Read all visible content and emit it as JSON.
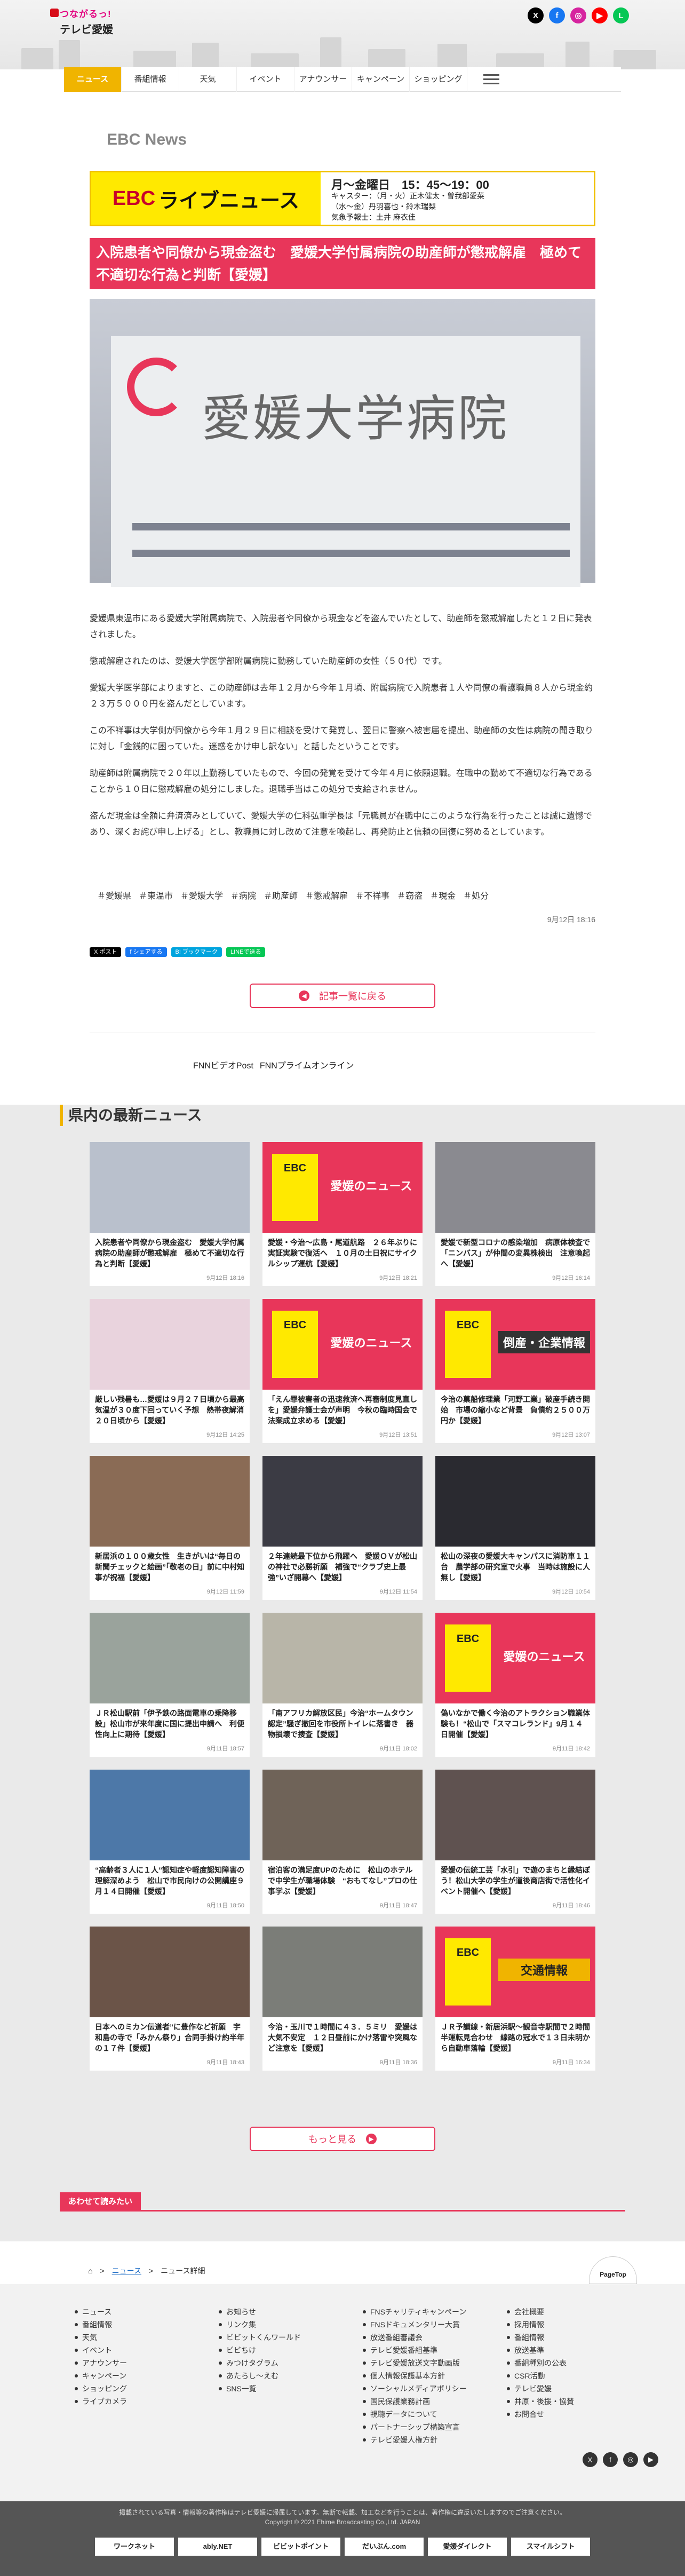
{
  "header": {
    "logo_line1": "つながるっ!",
    "logo_line2": "テレビ愛媛",
    "sns": [
      {
        "name": "x",
        "glyph": "X",
        "color": "#000000"
      },
      {
        "name": "facebook",
        "glyph": "f",
        "color": "#1877f2"
      },
      {
        "name": "instagram",
        "glyph": "◎",
        "color": "#d6249f"
      },
      {
        "name": "youtube",
        "glyph": "▶",
        "color": "#ff0000"
      },
      {
        "name": "line",
        "glyph": "L",
        "color": "#06c755"
      }
    ]
  },
  "nav": {
    "items": [
      "ニュース",
      "番組情報",
      "天気",
      "イベント",
      "アナウンサー",
      "キャンペーン",
      "ショッピング"
    ]
  },
  "section_title": "EBC News",
  "banner": {
    "brand": "EBC",
    "program": "ライブニュース",
    "time": "月～金曜日　15：45～19：00",
    "caster1": "キャスター：（月・火）正木健太・曽我部愛菜",
    "caster2": "（水～金）丹羽喜也・鈴木瑞梨",
    "weather": "気象予報士：土井 麻衣佳"
  },
  "article": {
    "headline": "入院患者や同僚から現金盗む　愛媛大学付属病院の助産師が懲戒解雇　極めて不適切な行為と判断【愛媛】",
    "photo_sign": "愛媛大学病院",
    "paragraphs": [
      "愛媛県東温市にある愛媛大学附属病院で、入院患者や同僚から現金などを盗んでいたとして、助産師を懲戒解雇したと１２日に発表されました。",
      "懲戒解雇されたのは、愛媛大学医学部附属病院に勤務していた助産師の女性（５０代）です。",
      "愛媛大学医学部によりますと、この助産師は去年１２月から今年１月頃、附属病院で入院患者１人や同僚の看護職員８人から現金約２３万５０００円を盗んだとしています。",
      "この不祥事は大学側が同僚から今年１月２９日に相談を受けて発覚し、翌日に警察へ被害届を提出、助産師の女性は病院の聞き取りに対し「金銭的に困っていた。迷惑をかけ申し訳ない」と話したということです。",
      "助産師は附属病院で２０年以上勤務していたもので、今回の発覚を受けて今年４月に依願退職。在職中の勤めて不適切な行為であることから１０日に懲戒解雇の処分にしました。退職手当はこの処分で支給されません。",
      "盗んだ現金は全額に弁済済みとしていて、愛媛大学の仁科弘重学長は「元職員が在職中にこのような行為を行ったことは誠に遺憾であり、深くお詫び申し上げる」とし、教職員に対し改めて注意を喚起し、再発防止と信頼の回復に努めるとしています。"
    ],
    "tags": [
      "＃愛媛県",
      "＃東温市",
      "＃愛媛大学",
      "＃病院",
      "＃助産師",
      "＃懲戒解雇",
      "＃不祥事",
      "＃窃盗",
      "＃現金",
      "＃処分"
    ],
    "date": "9月12日 18:16",
    "share": [
      "X ポスト",
      "f シェアする",
      "B! ブックマーク",
      "LINEで送る"
    ],
    "back_label": "記事一覧に戻る"
  },
  "partners": [
    "FNNビデオPost",
    "FNNプライムオンライン"
  ],
  "latest": {
    "title": "県内の最新ニュース",
    "cards": [
      {
        "title": "入院患者や同僚から現金盗む　愛媛大学付属病院の助産師が懲戒解雇　極めて不適切な行為と判断【愛媛】",
        "date": "9月12日 18:16",
        "thumb": "photo",
        "bg": "#b9c0cc"
      },
      {
        "title": "愛媛・今治～広島・尾道航路　２６年ぶりに実証実験で復活へ　１０月の土日祝にサイクルシップ運航【愛媛】",
        "date": "9月12日 18:21",
        "thumb": "ebc",
        "label": "愛媛のニュース",
        "style": ""
      },
      {
        "title": "愛媛で新型コロナの感染増加　病原体検査で「ニンバス」が仲間の変異株検出　注意喚起へ【愛媛】",
        "date": "9月12日 16:14",
        "thumb": "photo",
        "bg": "#8a8a90"
      },
      {
        "title": "厳しい残暑も…愛媛は９月２７日頃から最高気温が３０度下回っていく予想　熱帯夜解消２０日頃から【愛媛】",
        "date": "9月12日 14:25",
        "thumb": "photo",
        "bg": "#e9d3dd"
      },
      {
        "title": "「えん罪被害者の迅速救済へ再審制度見直しを」愛媛弁護士会が声明　今秋の臨時国会で法案成立求める【愛媛】",
        "date": "9月12日 13:51",
        "thumb": "ebc",
        "label": "愛媛のニュース",
        "style": ""
      },
      {
        "title": "今治の菓船修理業「河野工業」破産手続き開始　市場の縮小など背景　負債約２５００万円か【愛媛】",
        "date": "9月12日 13:07",
        "thumb": "ebc",
        "label": "倒産・企業情報",
        "style": "gray2"
      },
      {
        "title": "新居浜の１００歳女性　生きがいは“毎日の新聞チェックと絵画”「敬老の日」前に中村知事が祝福【愛媛】",
        "date": "9月12日 11:59",
        "thumb": "photo",
        "bg": "#8a6b55"
      },
      {
        "title": "２年連続最下位から飛躍へ　愛媛ＯＶが松山の神社で必勝祈願　補強で“クラブ史上最強”いざ開幕へ【愛媛】",
        "date": "9月12日 11:54",
        "thumb": "photo",
        "bg": "#3b3b44"
      },
      {
        "title": "松山の深夜の愛媛大キャンパスに消防車１１台　農学部の研究室で火事　当時は施設に人無し【愛媛】",
        "date": "9月12日 10:54",
        "thumb": "photo",
        "bg": "#2a2a30"
      },
      {
        "title": "ＪＲ松山駅前「伊予鉄の路面電車の乗降移設」松山市が来年度に国に提出申請へ　利便性向上に期待【愛媛】",
        "date": "9月11日 18:57",
        "thumb": "photo",
        "bg": "#9aa39c"
      },
      {
        "title": "「南アフリカ解放区民」今治“ホームタウン認定”騒ぎ撤回を市役所トイレに落書き　器物損壊で捜査【愛媛】",
        "date": "9月11日 18:02",
        "thumb": "photo",
        "bg": "#b8b5a8"
      },
      {
        "title": "偽いなかで働く今治のアトラクション職業体験も！“松山で「スマコレランド」9月１４日開催【愛媛】",
        "date": "9月11日 18:42",
        "thumb": "ebc",
        "label": "愛媛のニュース",
        "style": ""
      },
      {
        "title": "“高齢者３人に１人”認知症や軽度認知障害の理解深めよう　松山で市民向けの公開講座９月１４日開催【愛媛】",
        "date": "9月11日 18:50",
        "thumb": "photo",
        "bg": "#4d78a8"
      },
      {
        "title": "宿泊客の満足度UPのために　松山のホテルで中学生が職場体験　“おもてなし”プロの仕事学ぶ【愛媛】",
        "date": "9月11日 18:47",
        "thumb": "photo",
        "bg": "#6f6358"
      },
      {
        "title": "愛媛の伝統工芸「水引」で遊のまちと縁結ぼう！松山大学の学生が道後商店街で活性化イベント開催へ【愛媛】",
        "date": "9月11日 18:46",
        "thumb": "photo",
        "bg": "#5f5250"
      },
      {
        "title": "日本へのミカン伝道者”に豊作など祈願　宇和島の寺で「みかん祭り」合同手掛け約半年の１７件【愛媛】",
        "date": "9月11日 18:43",
        "thumb": "photo",
        "bg": "#6b5448"
      },
      {
        "title": "今治・玉川で１時間に４３．５ミリ　愛媛は大気不安定　１２日昼前にかけ落雷や突風など注意を【愛媛】",
        "date": "9月11日 18:36",
        "thumb": "photo",
        "bg": "#7b7d78"
      },
      {
        "title": "ＪＲ予讃線・新居浜駅～観音寺駅間で２時間半運転見合わせ　線路の冠水で１３日未明から自動車落輪【愛媛】",
        "date": "9月11日 16:34",
        "thumb": "ebc",
        "label": "交通情報",
        "style": "yel"
      }
    ],
    "more_label": "もっと見る"
  },
  "recommend_label": "あわせて読みたい",
  "breadcrumb": {
    "home": "⌂",
    "news": "ニュース",
    "detail": "ニュース詳細"
  },
  "pagetop_label": "PageTop",
  "footer": {
    "col1": [
      "ニュース",
      "番組情報",
      "天気",
      "イベント",
      "アナウンサー",
      "キャンペーン",
      "ショッピング",
      "ライブカメラ"
    ],
    "col2": [
      "お知らせ",
      "リンク集",
      "ビビットくんワールド",
      "ビビちけ",
      "みつけタグラム",
      "あたらし～えむ",
      "SNS一覧"
    ],
    "col3": [
      "FNSチャリティキャンペーン",
      "FNSドキュメンタリー大賞",
      "放送番組審議会",
      "テレビ愛媛番組基準",
      "テレビ愛媛放送文字動画版",
      "個人情報保護基本方針",
      "ソーシャルメディアポリシー",
      "国民保護業務計画",
      "視聴データについて",
      "パートナーシップ構築宣言",
      "テレビ愛媛人権方針"
    ],
    "col4": [
      "会社概要",
      "採用情報",
      "番組情報",
      "放送基準",
      "番組種別の公表",
      "CSR活動",
      "テレビ愛媛",
      "井原・後援・協賛",
      "お問合せ"
    ]
  },
  "copyright": {
    "line1": "掲載されている写真・情報等の著作権はテレビ愛媛に帰属しています。無断で転載、加工などを行うことは、著作権に違反いたしますのでご注意ください。",
    "line2": "Copyright © 2021 Ehime Broadcasting Co.,Ltd. JAPAN",
    "banners": [
      "ワークネット",
      "ably.NET",
      "ビビットポイント",
      "だいぶん.com",
      "愛媛ダイレクト",
      "スマイルシフト"
    ]
  }
}
